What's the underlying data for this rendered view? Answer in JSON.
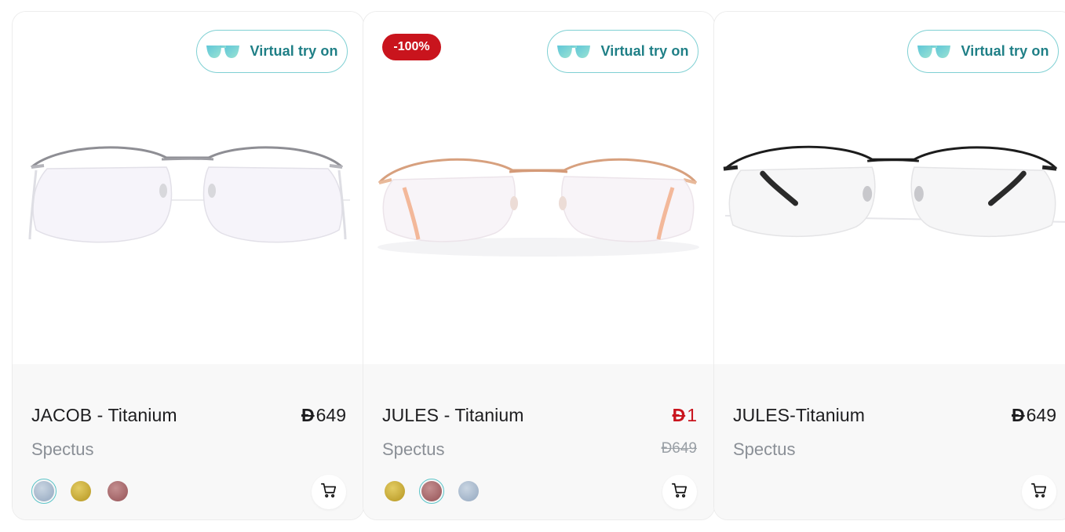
{
  "try_on_label": "Virtual try on",
  "currency_symbol": "Đ",
  "colors": {
    "accent": "#1f7f86",
    "sale_badge": "#c9141d",
    "sale_price": "#c9141d"
  },
  "products": [
    {
      "name": "JACOB - Titanium",
      "brand": "Spectus",
      "price": "649",
      "frame_color": "silver",
      "swatches": [
        {
          "name": "silver-blue",
          "color": "#a9b8cc",
          "selected": true
        },
        {
          "name": "gold",
          "color": "#c8ad3c",
          "selected": false
        },
        {
          "name": "rose",
          "color": "#a86b6e",
          "selected": false
        }
      ]
    },
    {
      "name": "JULES - Titanium",
      "brand": "Spectus",
      "badge": "-100%",
      "price": "1",
      "old_price": "649",
      "frame_color": "rose-gold",
      "swatches": [
        {
          "name": "gold",
          "color": "#c8ad3c",
          "selected": false
        },
        {
          "name": "rose",
          "color": "#a86b6e",
          "selected": true
        },
        {
          "name": "silver-blue",
          "color": "#a9b8cc",
          "selected": false
        }
      ]
    },
    {
      "name": "JULES-Titanium",
      "brand": "Spectus",
      "price": "649",
      "frame_color": "black",
      "swatches": []
    }
  ]
}
